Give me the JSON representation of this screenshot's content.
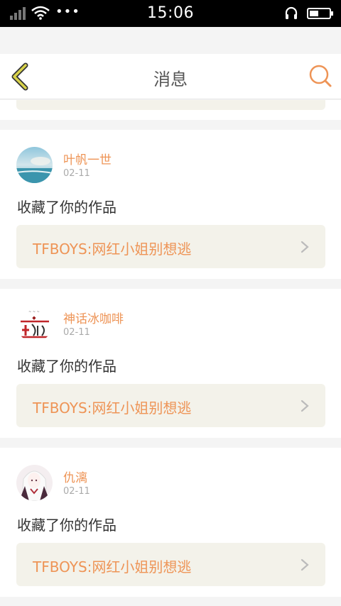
{
  "status_bar": {
    "time": "15:06",
    "more": "•••",
    "battery_level": 0.45
  },
  "header": {
    "title": "消息",
    "back_icon": "back-chevron-icon",
    "search_icon": "search-icon"
  },
  "messages": [
    {
      "user": "叶帆一世",
      "date": "02-11",
      "action": "收藏了你的作品",
      "work": "TFBOYS:网红小姐别想逃",
      "avatar": "beach-avatar"
    },
    {
      "user": "神话冰咖啡",
      "date": "02-11",
      "action": "收藏了你的作品",
      "work": "TFBOYS:网红小姐别想逃",
      "avatar": "calligraphy-avatar"
    },
    {
      "user": "仇漓",
      "date": "02-11",
      "action": "收藏了你的作品",
      "work": "TFBOYS:网红小姐别想逃",
      "avatar": "anime-avatar"
    }
  ],
  "colors": {
    "accent": "#ee9456",
    "back_icon": "#c8c23a",
    "card_box": "#f3f2ea"
  }
}
